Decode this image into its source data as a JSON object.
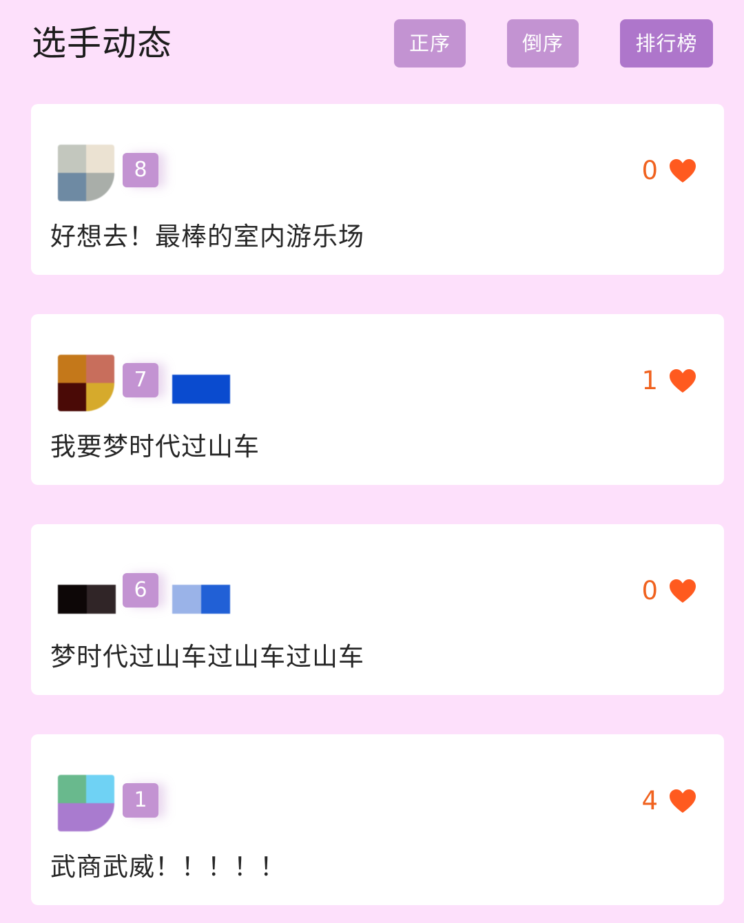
{
  "header": {
    "title": "选手动态",
    "buttons": {
      "asc_label": "正序",
      "desc_label": "倒序",
      "rank_label": "排行榜"
    }
  },
  "posts": [
    {
      "rank": "8",
      "likes": "0",
      "comment": "好想去！最棒的室内游乐场"
    },
    {
      "rank": "7",
      "likes": "1",
      "comment": "我要梦时代过山车"
    },
    {
      "rank": "6",
      "likes": "0",
      "comment": "梦时代过山车过山车过山车"
    },
    {
      "rank": "1",
      "likes": "4",
      "comment": "武商武威！！！！！"
    }
  ],
  "icons": {
    "like": "heart-icon"
  },
  "colors": {
    "background": "#fde0fb",
    "button": "#c393d2",
    "button_active": "#ae76cb",
    "like": "#f0621f",
    "heart": "#ff5a1f"
  }
}
